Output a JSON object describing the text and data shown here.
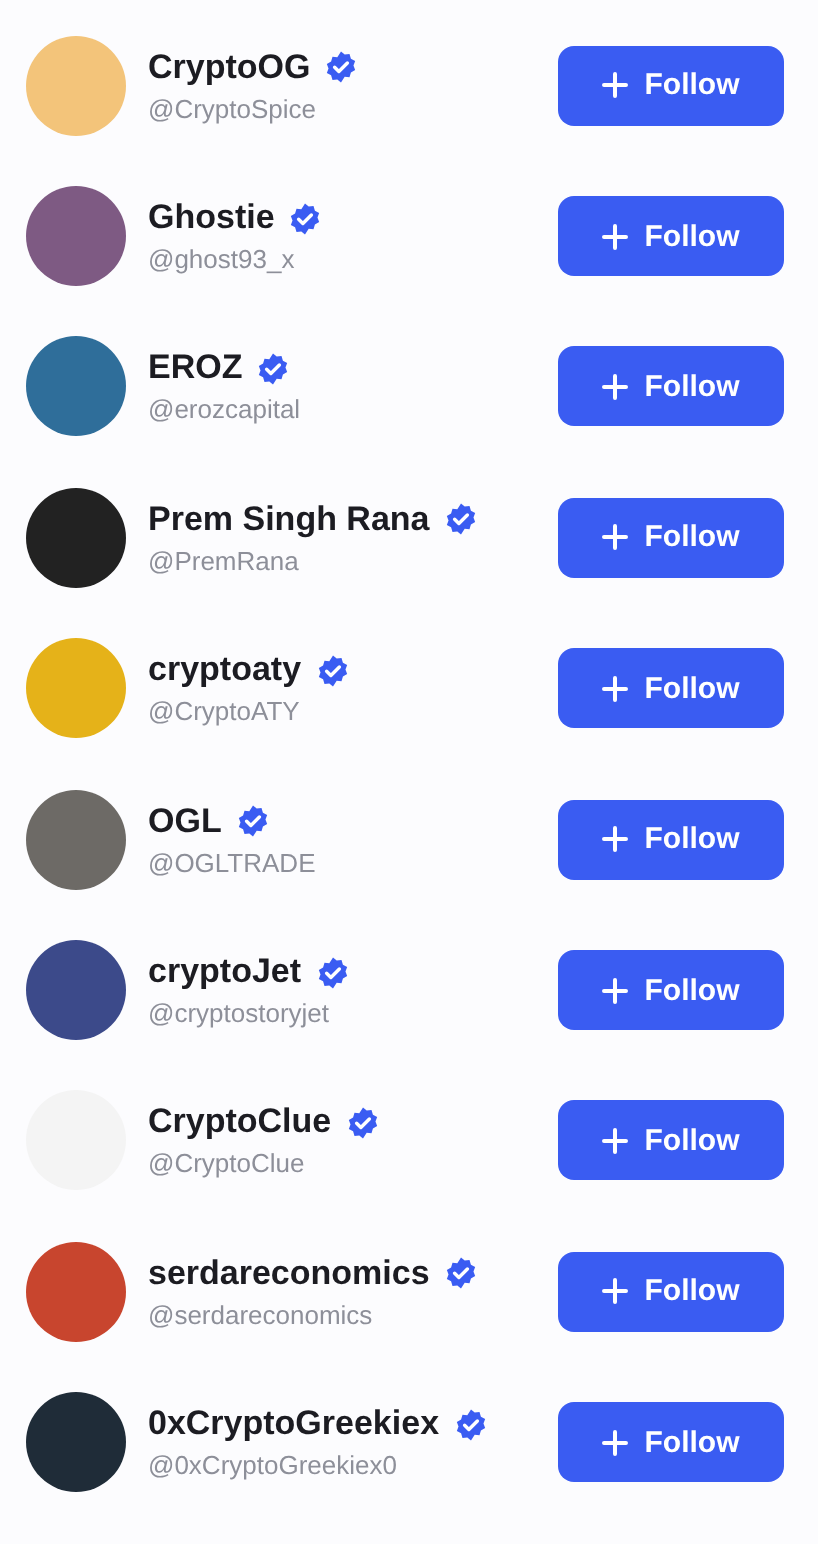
{
  "users": [
    {
      "name": "CryptoOG",
      "handle": "@CryptoSpice",
      "verified": true,
      "button": "Follow"
    },
    {
      "name": "Ghostie",
      "handle": "@ghost93_x",
      "verified": true,
      "button": "Follow"
    },
    {
      "name": "EROZ",
      "handle": "@erozcapital",
      "verified": true,
      "button": "Follow"
    },
    {
      "name": "Prem Singh Rana",
      "handle": "@PremRana",
      "verified": true,
      "button": "Follow"
    },
    {
      "name": "cryptoaty",
      "handle": "@CryptoATY",
      "verified": true,
      "button": "Follow"
    },
    {
      "name": "OGL",
      "handle": "@OGLTRADE",
      "verified": true,
      "button": "Follow"
    },
    {
      "name": "cryptoJet",
      "handle": "@cryptostoryjet",
      "verified": true,
      "button": "Follow"
    },
    {
      "name": "CryptoClue",
      "handle": "@CryptoClue",
      "verified": true,
      "button": "Follow"
    },
    {
      "name": "serdareconomics",
      "handle": "@serdareconomics",
      "verified": true,
      "button": "Follow"
    },
    {
      "name": "0xCryptoGreekiex",
      "handle": "@0xCryptoGreekiex0",
      "verified": true,
      "button": "Follow"
    }
  ]
}
